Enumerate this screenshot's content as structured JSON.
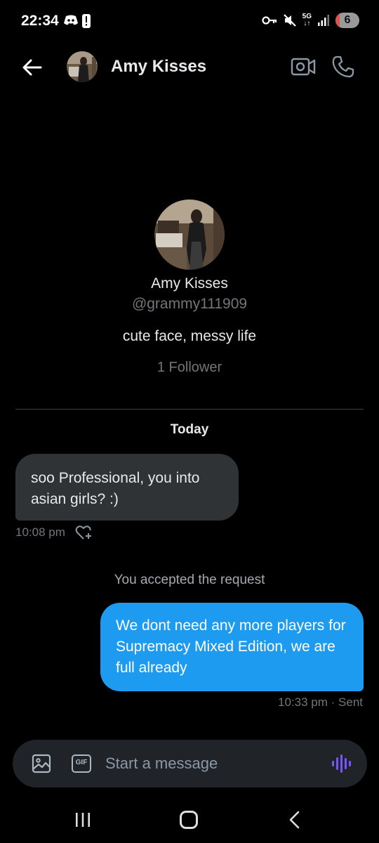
{
  "status_bar": {
    "time": "22:34",
    "network": "5G",
    "battery": "6",
    "battery_level": 0.06,
    "icons": [
      "discord-icon",
      "alert-icon",
      "key-icon",
      "mute-icon",
      "signal-icon",
      "battery-icon"
    ]
  },
  "header": {
    "name": "Amy Kisses",
    "icons": [
      "back-arrow-icon",
      "video-call-icon",
      "phone-icon"
    ]
  },
  "profile": {
    "name": "Amy Kisses",
    "handle": "@grammy111909",
    "bio": "cute face, messy life",
    "followers": "1 Follower"
  },
  "conversation": {
    "day_label": "Today",
    "incoming": {
      "text": "soo Professional, you into asian girls? :)",
      "time": "10:08 pm"
    },
    "system_note": "You accepted the request",
    "outgoing": {
      "text": "We dont need any more players for Supremacy Mixed Edition, we are full already",
      "meta": "10:33 pm · Sent"
    }
  },
  "composer": {
    "placeholder": "Start a message",
    "gif_label": "GIF"
  },
  "colors": {
    "background": "#000000",
    "incoming_bubble": "#2f3336",
    "outgoing_bubble": "#1d9bf0",
    "voice_accent": "#7856ff",
    "secondary_text": "#71767b"
  }
}
